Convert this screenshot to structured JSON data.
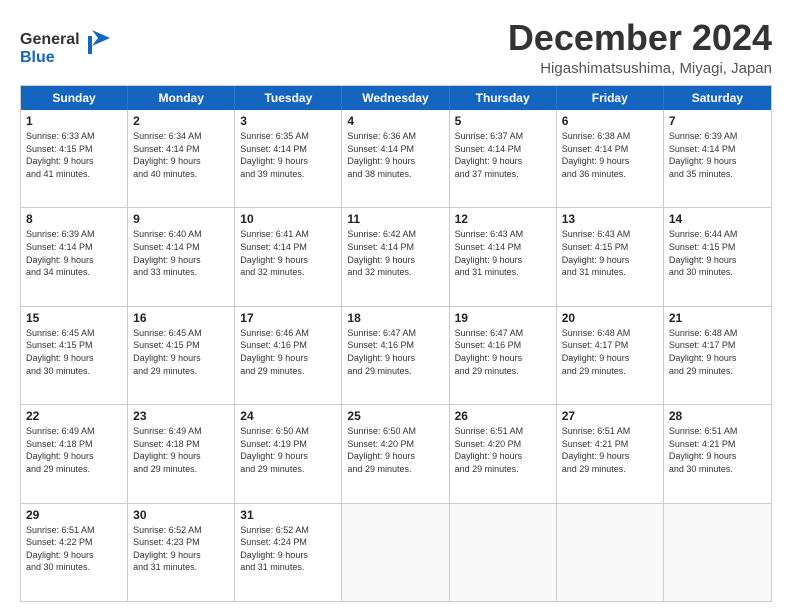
{
  "logo": {
    "line1": "General",
    "line2": "Blue"
  },
  "title": "December 2024",
  "subtitle": "Higashimatsushima, Miyagi, Japan",
  "days_of_week": [
    "Sunday",
    "Monday",
    "Tuesday",
    "Wednesday",
    "Thursday",
    "Friday",
    "Saturday"
  ],
  "weeks": [
    [
      {
        "day": "1",
        "lines": [
          "Sunrise: 6:33 AM",
          "Sunset: 4:15 PM",
          "Daylight: 9 hours",
          "and 41 minutes."
        ]
      },
      {
        "day": "2",
        "lines": [
          "Sunrise: 6:34 AM",
          "Sunset: 4:14 PM",
          "Daylight: 9 hours",
          "and 40 minutes."
        ]
      },
      {
        "day": "3",
        "lines": [
          "Sunrise: 6:35 AM",
          "Sunset: 4:14 PM",
          "Daylight: 9 hours",
          "and 39 minutes."
        ]
      },
      {
        "day": "4",
        "lines": [
          "Sunrise: 6:36 AM",
          "Sunset: 4:14 PM",
          "Daylight: 9 hours",
          "and 38 minutes."
        ]
      },
      {
        "day": "5",
        "lines": [
          "Sunrise: 6:37 AM",
          "Sunset: 4:14 PM",
          "Daylight: 9 hours",
          "and 37 minutes."
        ]
      },
      {
        "day": "6",
        "lines": [
          "Sunrise: 6:38 AM",
          "Sunset: 4:14 PM",
          "Daylight: 9 hours",
          "and 36 minutes."
        ]
      },
      {
        "day": "7",
        "lines": [
          "Sunrise: 6:39 AM",
          "Sunset: 4:14 PM",
          "Daylight: 9 hours",
          "and 35 minutes."
        ]
      }
    ],
    [
      {
        "day": "8",
        "lines": [
          "Sunrise: 6:39 AM",
          "Sunset: 4:14 PM",
          "Daylight: 9 hours",
          "and 34 minutes."
        ]
      },
      {
        "day": "9",
        "lines": [
          "Sunrise: 6:40 AM",
          "Sunset: 4:14 PM",
          "Daylight: 9 hours",
          "and 33 minutes."
        ]
      },
      {
        "day": "10",
        "lines": [
          "Sunrise: 6:41 AM",
          "Sunset: 4:14 PM",
          "Daylight: 9 hours",
          "and 32 minutes."
        ]
      },
      {
        "day": "11",
        "lines": [
          "Sunrise: 6:42 AM",
          "Sunset: 4:14 PM",
          "Daylight: 9 hours",
          "and 32 minutes."
        ]
      },
      {
        "day": "12",
        "lines": [
          "Sunrise: 6:43 AM",
          "Sunset: 4:14 PM",
          "Daylight: 9 hours",
          "and 31 minutes."
        ]
      },
      {
        "day": "13",
        "lines": [
          "Sunrise: 6:43 AM",
          "Sunset: 4:15 PM",
          "Daylight: 9 hours",
          "and 31 minutes."
        ]
      },
      {
        "day": "14",
        "lines": [
          "Sunrise: 6:44 AM",
          "Sunset: 4:15 PM",
          "Daylight: 9 hours",
          "and 30 minutes."
        ]
      }
    ],
    [
      {
        "day": "15",
        "lines": [
          "Sunrise: 6:45 AM",
          "Sunset: 4:15 PM",
          "Daylight: 9 hours",
          "and 30 minutes."
        ]
      },
      {
        "day": "16",
        "lines": [
          "Sunrise: 6:45 AM",
          "Sunset: 4:15 PM",
          "Daylight: 9 hours",
          "and 29 minutes."
        ]
      },
      {
        "day": "17",
        "lines": [
          "Sunrise: 6:46 AM",
          "Sunset: 4:16 PM",
          "Daylight: 9 hours",
          "and 29 minutes."
        ]
      },
      {
        "day": "18",
        "lines": [
          "Sunrise: 6:47 AM",
          "Sunset: 4:16 PM",
          "Daylight: 9 hours",
          "and 29 minutes."
        ]
      },
      {
        "day": "19",
        "lines": [
          "Sunrise: 6:47 AM",
          "Sunset: 4:16 PM",
          "Daylight: 9 hours",
          "and 29 minutes."
        ]
      },
      {
        "day": "20",
        "lines": [
          "Sunrise: 6:48 AM",
          "Sunset: 4:17 PM",
          "Daylight: 9 hours",
          "and 29 minutes."
        ]
      },
      {
        "day": "21",
        "lines": [
          "Sunrise: 6:48 AM",
          "Sunset: 4:17 PM",
          "Daylight: 9 hours",
          "and 29 minutes."
        ]
      }
    ],
    [
      {
        "day": "22",
        "lines": [
          "Sunrise: 6:49 AM",
          "Sunset: 4:18 PM",
          "Daylight: 9 hours",
          "and 29 minutes."
        ]
      },
      {
        "day": "23",
        "lines": [
          "Sunrise: 6:49 AM",
          "Sunset: 4:18 PM",
          "Daylight: 9 hours",
          "and 29 minutes."
        ]
      },
      {
        "day": "24",
        "lines": [
          "Sunrise: 6:50 AM",
          "Sunset: 4:19 PM",
          "Daylight: 9 hours",
          "and 29 minutes."
        ]
      },
      {
        "day": "25",
        "lines": [
          "Sunrise: 6:50 AM",
          "Sunset: 4:20 PM",
          "Daylight: 9 hours",
          "and 29 minutes."
        ]
      },
      {
        "day": "26",
        "lines": [
          "Sunrise: 6:51 AM",
          "Sunset: 4:20 PM",
          "Daylight: 9 hours",
          "and 29 minutes."
        ]
      },
      {
        "day": "27",
        "lines": [
          "Sunrise: 6:51 AM",
          "Sunset: 4:21 PM",
          "Daylight: 9 hours",
          "and 29 minutes."
        ]
      },
      {
        "day": "28",
        "lines": [
          "Sunrise: 6:51 AM",
          "Sunset: 4:21 PM",
          "Daylight: 9 hours",
          "and 30 minutes."
        ]
      }
    ],
    [
      {
        "day": "29",
        "lines": [
          "Sunrise: 6:51 AM",
          "Sunset: 4:22 PM",
          "Daylight: 9 hours",
          "and 30 minutes."
        ]
      },
      {
        "day": "30",
        "lines": [
          "Sunrise: 6:52 AM",
          "Sunset: 4:23 PM",
          "Daylight: 9 hours",
          "and 31 minutes."
        ]
      },
      {
        "day": "31",
        "lines": [
          "Sunrise: 6:52 AM",
          "Sunset: 4:24 PM",
          "Daylight: 9 hours",
          "and 31 minutes."
        ]
      },
      {
        "day": "",
        "lines": []
      },
      {
        "day": "",
        "lines": []
      },
      {
        "day": "",
        "lines": []
      },
      {
        "day": "",
        "lines": []
      }
    ]
  ]
}
